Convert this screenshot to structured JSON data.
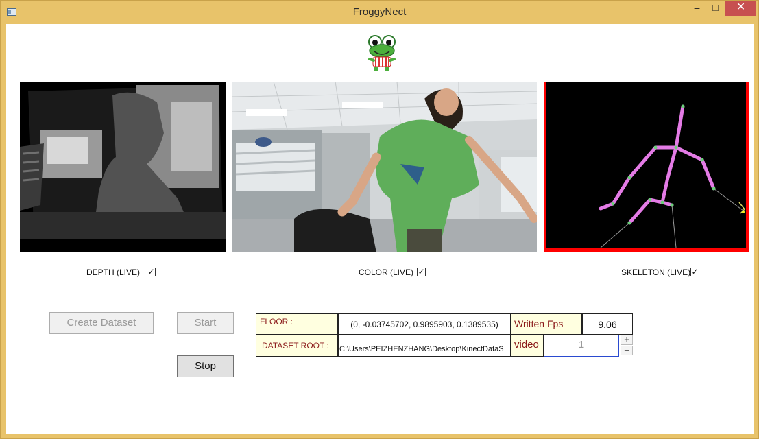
{
  "window": {
    "title": "FroggyNect",
    "controls": {
      "minimize": "–",
      "maximize": "□",
      "close": "✕"
    }
  },
  "logo": {
    "icon": "frog-mascot-icon"
  },
  "panels": {
    "depth": {
      "caption": "DEPTH (LIVE)",
      "checked": true
    },
    "color": {
      "caption": "COLOR (LIVE)",
      "checked": true
    },
    "skeleton": {
      "caption": "SKELETON (LIVE)",
      "checked": true
    }
  },
  "buttons": {
    "create_dataset": "Create Dataset",
    "start": "Start",
    "stop": "Stop"
  },
  "info": {
    "floor_label": "FLOOR :",
    "floor_value": "(0, -0.03745702, 0.9895903, 0.1389535)",
    "dataset_root_label": "DATASET ROOT :",
    "dataset_root_value": "C:\\Users\\PEIZHENZHANG\\Desktop\\KinectDataS",
    "written_fps_label": "Written Fps",
    "written_fps_value": "9.06",
    "video_label": "video",
    "video_value": "1",
    "stepper_up": "+",
    "stepper_down": "−"
  },
  "colors": {
    "title_bar": "#e8c36a",
    "close_button": "#c75050",
    "skeleton_bone": "#e47be6",
    "skeleton_border": "#ff0000",
    "label_text": "#8b1a1a"
  }
}
